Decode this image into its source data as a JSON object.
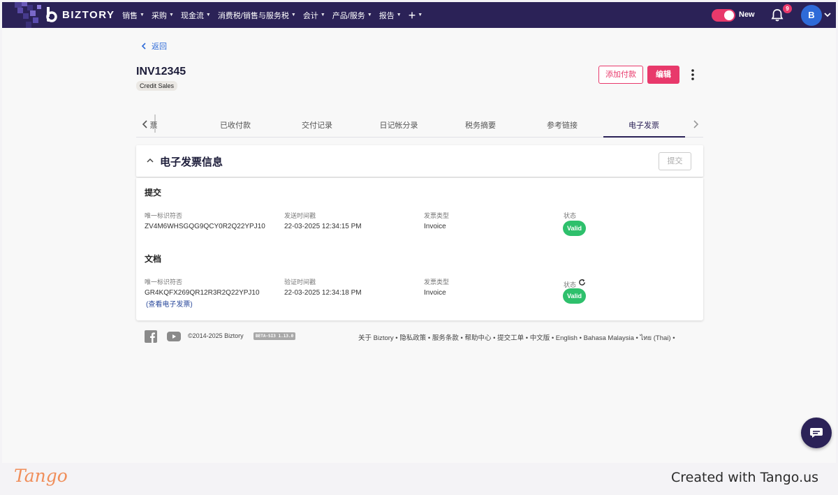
{
  "nav": {
    "logo": "BIZTORY",
    "menu": [
      {
        "label": "销售"
      },
      {
        "label": "采购"
      },
      {
        "label": "现金流"
      },
      {
        "label": "消费税/销售与服务税"
      },
      {
        "label": "会计"
      },
      {
        "label": "产品/服务"
      },
      {
        "label": "报告"
      }
    ],
    "plus": "+",
    "toggle_label": "New",
    "notif_count": "9",
    "avatar_letter": "B"
  },
  "page": {
    "back_label": "返回",
    "invoice_no": "INV12345",
    "invoice_tag": "Credit Sales",
    "btn_add_payment": "添加付款",
    "btn_edit": "编辑"
  },
  "tabs": [
    "票",
    "已收付款",
    "交付记录",
    "日记帐分录",
    "税务摘要",
    "参考链接",
    "电子发票"
  ],
  "active_tab": "电子发票",
  "einvoice": {
    "title": "电子发票信息",
    "submit_btn": "提交",
    "submission": {
      "title": "提交",
      "uid_label": "唯一标识符否",
      "uid": "ZV4M6WHSGQG9QCY0R2Q22YPJ10",
      "time_label": "发送时间戳",
      "time": "22-03-2025 12:34:15 PM",
      "type_label": "发票类型",
      "type": "Invoice",
      "status_label": "状态",
      "status": "Valid"
    },
    "document": {
      "title": "文档",
      "uid_label": "唯一标识符否",
      "uid": "GR4KQFX269QR12R3R2Q22YPJ10",
      "view_link": "(查看电子发票)",
      "time_label": "验证时间戳",
      "time": "22-03-2025 12:34:18 PM",
      "type_label": "发票类型",
      "type": "Invoice",
      "status_label": "状态",
      "status": "Valid"
    }
  },
  "footer": {
    "copyright": "©2014-2025 Biztory",
    "version": "BETA-SI3 1.13.0",
    "links": "关于 Biztory • 隐私政策 • 服务条款 • 帮助中心 • 提交工单 • 中文版 • English • Bahasa Malaysia • ไทย (Thai) •"
  },
  "tango": {
    "logo": "Tango",
    "credit": "Created with Tango.us"
  },
  "colors": {
    "nav_bg": "#2b2257",
    "accent": "#e8396b",
    "valid": "#2ec06c",
    "link": "#2f6bd8"
  }
}
